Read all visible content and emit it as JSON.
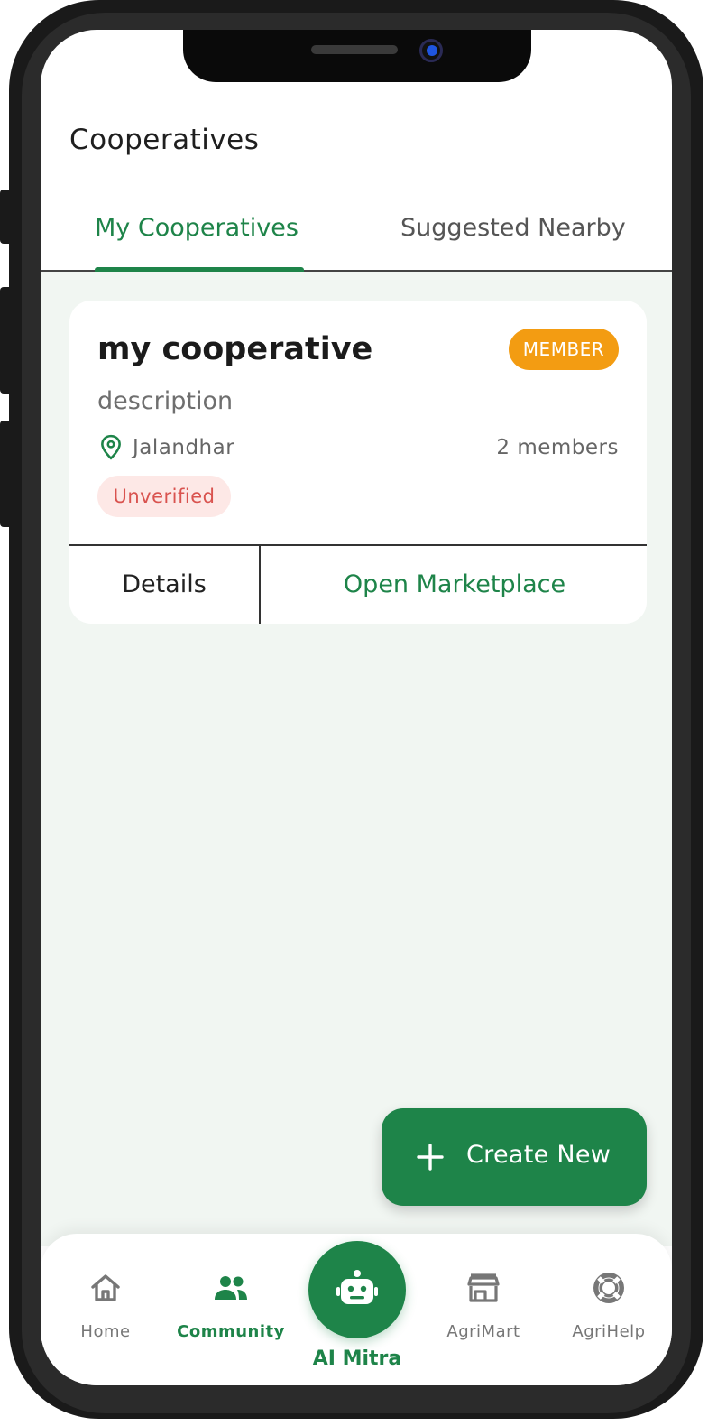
{
  "page": {
    "title": "Cooperatives"
  },
  "tabs": [
    {
      "label": "My Cooperatives",
      "active": true
    },
    {
      "label": "Suggested Nearby",
      "active": false
    }
  ],
  "card": {
    "name": "my cooperative",
    "badge": "MEMBER",
    "description": "description",
    "location": "Jalandhar",
    "members": "2 members",
    "status": "Unverified",
    "actions": {
      "details": "Details",
      "marketplace": "Open Marketplace"
    }
  },
  "fab": {
    "label": "Create New",
    "icon": "plus-icon"
  },
  "nav": {
    "items": [
      {
        "label": "Home",
        "icon": "home-icon",
        "active": false
      },
      {
        "label": "Community",
        "icon": "people-icon",
        "active": true
      },
      {
        "label": "AgriMart",
        "icon": "store-icon",
        "active": false
      },
      {
        "label": "AgriHelp",
        "icon": "lifebuoy-icon",
        "active": false
      }
    ],
    "ai": {
      "label": "AI Mitra",
      "icon": "robot-icon"
    }
  },
  "colors": {
    "primary": "#1e8449",
    "badge": "#f39c12",
    "unverified_text": "#d9534f",
    "unverified_bg": "#fde8e6",
    "content_bg": "#f1f6f2"
  }
}
